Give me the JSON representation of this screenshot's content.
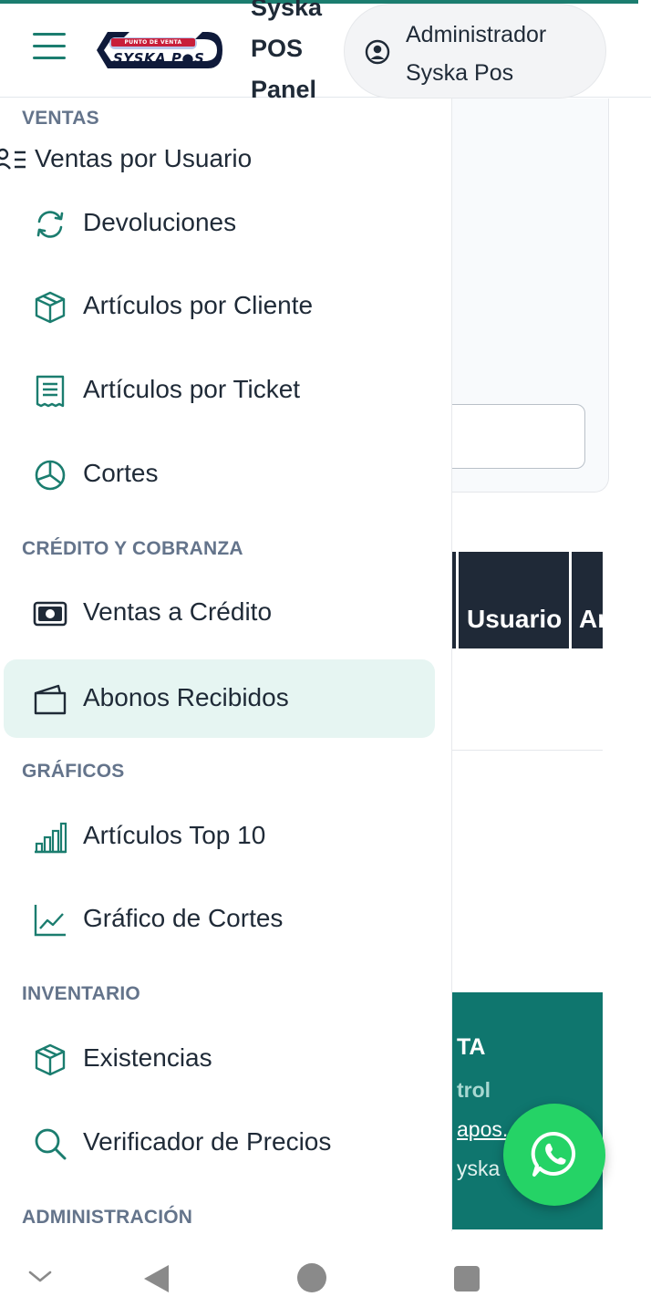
{
  "header": {
    "logo_tagline": "PUNTO DE VENTA",
    "logo_text": "SYSKA P●S",
    "title": "Syska POS Panel",
    "user_name": "Administrador Syska Pos",
    "icons": {
      "menu": "hamburger-icon",
      "user": "user-circle-icon"
    }
  },
  "drawer": {
    "sections": {
      "ventas": "VENTAS",
      "credito": "CRÉDITO Y COBRANZA",
      "graficos": "GRÁFICOS",
      "inventario": "INVENTARIO",
      "administracion": "ADMINISTRACIÓN"
    },
    "items": [
      {
        "label": "Ventas por Usuario",
        "icon": "user-list-icon"
      },
      {
        "label": "Devoluciones",
        "icon": "refresh-icon"
      },
      {
        "label": "Artículos por Cliente",
        "icon": "box-icon"
      },
      {
        "label": "Artículos por Ticket",
        "icon": "receipt-icon"
      },
      {
        "label": "Cortes",
        "icon": "pie-chart-icon"
      },
      {
        "label": "Ventas a Crédito",
        "icon": "cash-icon"
      },
      {
        "label": "Abonos Recibidos",
        "icon": "wallet-icon",
        "active": true
      },
      {
        "label": "Artículos Top 10",
        "icon": "bar-chart-icon"
      },
      {
        "label": "Gráfico de Cortes",
        "icon": "line-chart-icon"
      },
      {
        "label": "Existencias",
        "icon": "box-icon"
      },
      {
        "label": "Verificador de Precios",
        "icon": "search-icon"
      }
    ]
  },
  "background_page": {
    "table_headers": [
      "Usuario",
      "Ar"
    ],
    "footer": {
      "title": "TA",
      "subtitle": "trol",
      "link": "apos.",
      "copyright": "yska I"
    }
  },
  "colors": {
    "accent": "#1b7d6f",
    "active_bg": "#e6f5f2",
    "section_title": "#64748b",
    "table_head": "#1f2937",
    "footer_bg": "#0f766e",
    "whatsapp": "#25d366"
  },
  "fab": {
    "icon": "whatsapp-icon"
  },
  "nav_bar": {
    "icons": [
      "collapse-icon",
      "back-icon",
      "home-icon",
      "recents-icon"
    ]
  }
}
